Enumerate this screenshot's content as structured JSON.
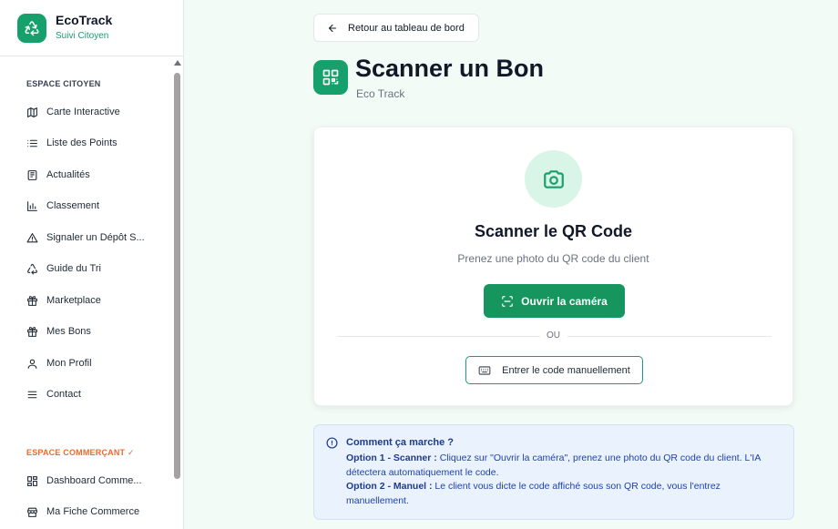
{
  "sidebar": {
    "brand_name": "EcoTrack",
    "brand_sub": "Suivi Citoyen",
    "citizen_section": "ESPACE CITOYEN",
    "items": [
      {
        "label": "Carte Interactive",
        "icon": "map-icon"
      },
      {
        "label": "Liste des Points",
        "icon": "list-icon"
      },
      {
        "label": "Actualités",
        "icon": "newspaper-icon"
      },
      {
        "label": "Classement",
        "icon": "bar-chart-icon"
      },
      {
        "label": "Signaler un Dépôt S...",
        "icon": "warning-icon"
      },
      {
        "label": "Guide du Tri",
        "icon": "recycle-icon"
      },
      {
        "label": "Marketplace",
        "icon": "gift-icon"
      },
      {
        "label": "Mes Bons",
        "icon": "gift-icon"
      },
      {
        "label": "Mon Profil",
        "icon": "user-icon"
      },
      {
        "label": "Contact",
        "icon": "menu-icon"
      }
    ],
    "merchant_section": "ESPACE COMMERÇANT ✓",
    "merchant_items": [
      {
        "label": "Dashboard Comme...",
        "icon": "dashboard-icon"
      },
      {
        "label": "Ma Fiche Commerce",
        "icon": "store-icon"
      }
    ]
  },
  "header": {
    "back_label": "Retour au tableau de bord",
    "title": "Scanner un Bon",
    "subtitle": "Eco Track"
  },
  "scan_card": {
    "title": "Scanner le QR Code",
    "subtitle": "Prenez une photo du QR code du client",
    "open_camera_label": "Ouvrir la caméra",
    "or_label": "OU",
    "manual_label": "Entrer le code manuellement"
  },
  "info": {
    "title": "Comment ça marche ?",
    "option1_label": "Option 1 - Scanner :",
    "option1_text": "Cliquez sur \"Ouvrir la caméra\", prenez une photo du QR code du client. L'IA détectera automatiquement le code.",
    "option2_label": "Option 2 - Manuel :",
    "option2_text": "Le client vous dicte le code affiché sous son QR code, vous l'entrez manuellement."
  },
  "colors": {
    "brand": "#16a06b",
    "button": "#16955f",
    "merchant_accent": "#ea6b2e",
    "info_bg": "#eaf3fd"
  }
}
